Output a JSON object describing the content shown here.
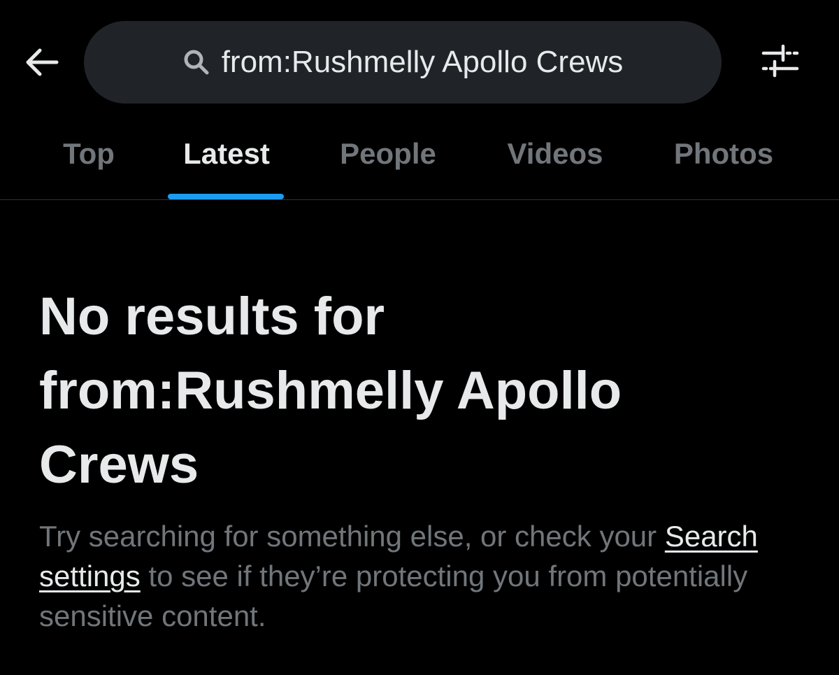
{
  "header": {
    "back_icon": "arrow-left-icon",
    "search": {
      "icon": "search-icon",
      "value": "from:Rushmelly Apollo Crews"
    },
    "filter_icon": "sliders-icon"
  },
  "tabs": [
    {
      "label": "Top",
      "active": false
    },
    {
      "label": "Latest",
      "active": true
    },
    {
      "label": "People",
      "active": false
    },
    {
      "label": "Videos",
      "active": false
    },
    {
      "label": "Photos",
      "active": false
    }
  ],
  "empty_state": {
    "title": "No results for from:Rushmelly Apollo Crews",
    "desc_before": "Try searching for something else, or check your ",
    "link_label": "Search settings",
    "desc_after": " to see if they’re protecting you from potentially sensitive content."
  },
  "colors": {
    "background": "#000000",
    "search_bg": "#202327",
    "primary_text": "#e7e9ea",
    "secondary_text": "#71767b",
    "accent": "#1d9bf0",
    "divider": "#2f3336"
  }
}
